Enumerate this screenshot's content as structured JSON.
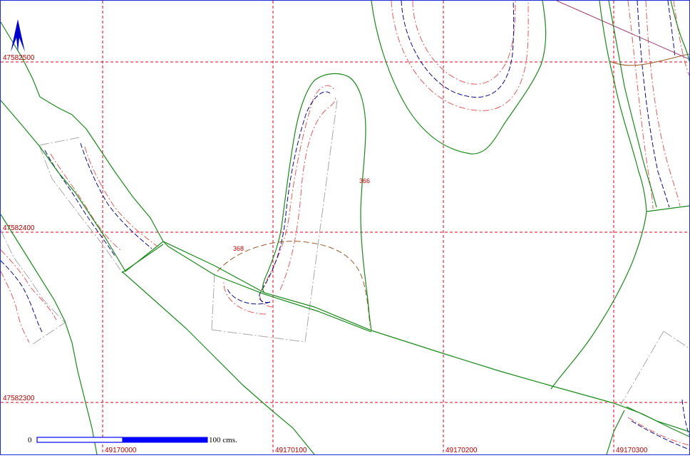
{
  "map": {
    "grid": {
      "line_color": "#e0001b",
      "northings": [
        {
          "value": 47582500,
          "label": "47582500"
        },
        {
          "value": 47582400,
          "label": "47582400"
        },
        {
          "value": 47582300,
          "label": "47582300"
        }
      ],
      "eastings": [
        {
          "value": 49170000,
          "label": "49170000"
        },
        {
          "value": 49170100,
          "label": "49170100"
        },
        {
          "value": 49170200,
          "label": "49170200"
        },
        {
          "value": 49170300,
          "label": "49170300"
        }
      ]
    },
    "contour_labels": [
      {
        "text": "366"
      },
      {
        "text": "368"
      }
    ],
    "north_arrow": {
      "icon": "north-arrow-icon",
      "color": "#0000cc"
    },
    "scale_bar": {
      "start_label": "0",
      "end_label": "100 cms.",
      "color": "#0000ff"
    },
    "colors": {
      "road": "#1a8a1a",
      "contour_blue": "#0a0a8a",
      "contour_red": "#e35a5a",
      "parcel": "#a8a8a8",
      "frame": "#1f2bd6",
      "brown": "#9a5a2a",
      "purple": "#a03a6a"
    }
  }
}
